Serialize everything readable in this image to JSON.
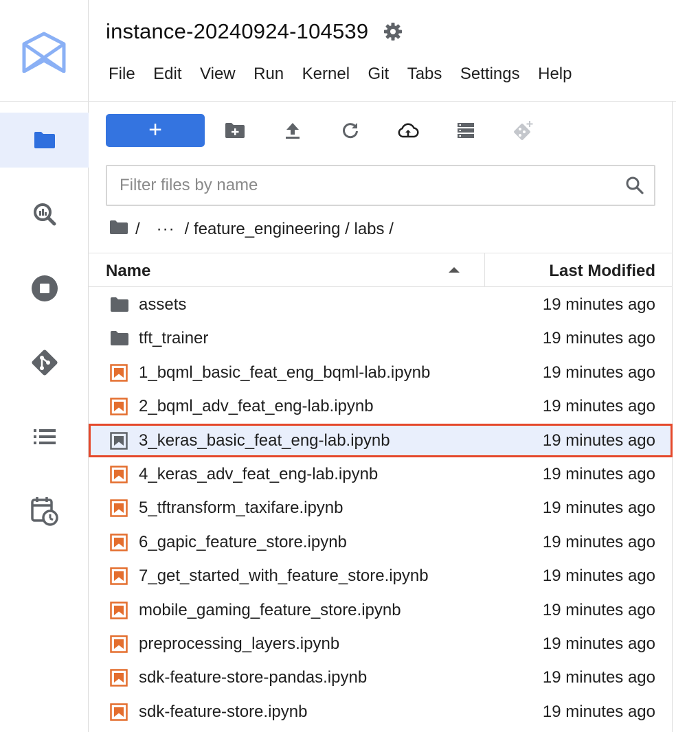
{
  "header": {
    "title": "instance-20240924-104539",
    "menu": [
      "File",
      "Edit",
      "View",
      "Run",
      "Kernel",
      "Git",
      "Tabs",
      "Settings",
      "Help"
    ]
  },
  "sidebar": {
    "items": [
      {
        "icon": "folder-icon",
        "active": true
      },
      {
        "icon": "bigquery-icon",
        "active": false
      },
      {
        "icon": "stop-circle-icon",
        "active": false
      },
      {
        "icon": "git-icon",
        "active": false
      },
      {
        "icon": "list-icon",
        "active": false
      },
      {
        "icon": "calendar-clock-icon",
        "active": false
      }
    ]
  },
  "toolbar": {
    "new_label": "+"
  },
  "filter": {
    "placeholder": "Filter files by name",
    "value": ""
  },
  "breadcrumb": {
    "root_sep": "/",
    "ellipsis": "···",
    "path": "/ feature_engineering / labs /"
  },
  "columns": {
    "name": "Name",
    "modified": "Last Modified"
  },
  "files": [
    {
      "name": "assets",
      "type": "folder",
      "modified": "19 minutes ago"
    },
    {
      "name": "tft_trainer",
      "type": "folder",
      "modified": "19 minutes ago"
    },
    {
      "name": "1_bqml_basic_feat_eng_bqml-lab.ipynb",
      "type": "notebook",
      "modified": "19 minutes ago"
    },
    {
      "name": "2_bqml_adv_feat_eng-lab.ipynb",
      "type": "notebook",
      "modified": "19 minutes ago"
    },
    {
      "name": "3_keras_basic_feat_eng-lab.ipynb",
      "type": "notebook",
      "modified": "19 minutes ago",
      "selected": true
    },
    {
      "name": "4_keras_adv_feat_eng-lab.ipynb",
      "type": "notebook",
      "modified": "19 minutes ago"
    },
    {
      "name": "5_tftransform_taxifare.ipynb",
      "type": "notebook",
      "modified": "19 minutes ago"
    },
    {
      "name": "6_gapic_feature_store.ipynb",
      "type": "notebook",
      "modified": "19 minutes ago"
    },
    {
      "name": "7_get_started_with_feature_store.ipynb",
      "type": "notebook",
      "modified": "19 minutes ago"
    },
    {
      "name": "mobile_gaming_feature_store.ipynb",
      "type": "notebook",
      "modified": "19 minutes ago"
    },
    {
      "name": "preprocessing_layers.ipynb",
      "type": "notebook",
      "modified": "19 minutes ago"
    },
    {
      "name": "sdk-feature-store-pandas.ipynb",
      "type": "notebook",
      "modified": "19 minutes ago"
    },
    {
      "name": "sdk-feature-store.ipynb",
      "type": "notebook",
      "modified": "19 minutes ago"
    }
  ],
  "colors": {
    "accent": "#3474e0",
    "notebook_icon": "#e46e2e",
    "selected_border": "#e5482a",
    "selected_bg": "#e9effc"
  }
}
